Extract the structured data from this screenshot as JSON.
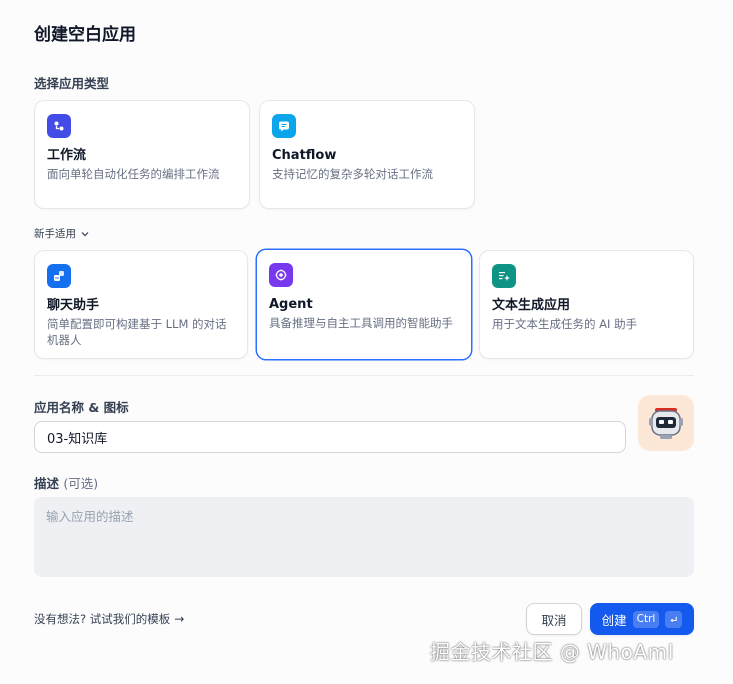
{
  "dialog": {
    "title": "创建空白应用",
    "section_type_label": "选择应用类型",
    "newbie_label": "新手适用"
  },
  "app_types_primary": [
    {
      "title": "工作流",
      "desc": "面向单轮自动化任务的编排工作流",
      "icon": "workflow-icon",
      "color": "#444ce7"
    },
    {
      "title": "Chatflow",
      "desc": "支持记忆的复杂多轮对话工作流",
      "icon": "chatflow-icon",
      "color": "#0ba5ec"
    }
  ],
  "app_types_newbie": [
    {
      "title": "聊天助手",
      "desc": "简单配置即可构建基于 LLM 的对话机器人",
      "icon": "chatbot-icon",
      "color": "#1570ef"
    },
    {
      "title": "Agent",
      "desc": "具备推理与自主工具调用的智能助手",
      "icon": "agent-icon",
      "color": "#7839ee",
      "selected": true
    },
    {
      "title": "文本生成应用",
      "desc": "用于文本生成任务的 AI 助手",
      "icon": "text-generation-icon",
      "color": "#0e9384"
    }
  ],
  "form": {
    "name_label": "应用名称 & 图标",
    "name_value": "03-知识库",
    "avatar": "robot-avatar-icon",
    "desc_label": "描述",
    "desc_optional": "(可选)",
    "desc_placeholder": "输入应用的描述"
  },
  "footer": {
    "template_hint": "没有想法? 试试我们的模板",
    "template_arrow": "→",
    "cancel_label": "取消",
    "create_label": "创建",
    "shortcut_ctrl": "Ctrl"
  },
  "watermark": "掘金技术社区 @ WhoAmI",
  "colors": {
    "accent": "#155aef",
    "selected_border": "#2970ff",
    "avatar_bg": "#fde7d6"
  }
}
